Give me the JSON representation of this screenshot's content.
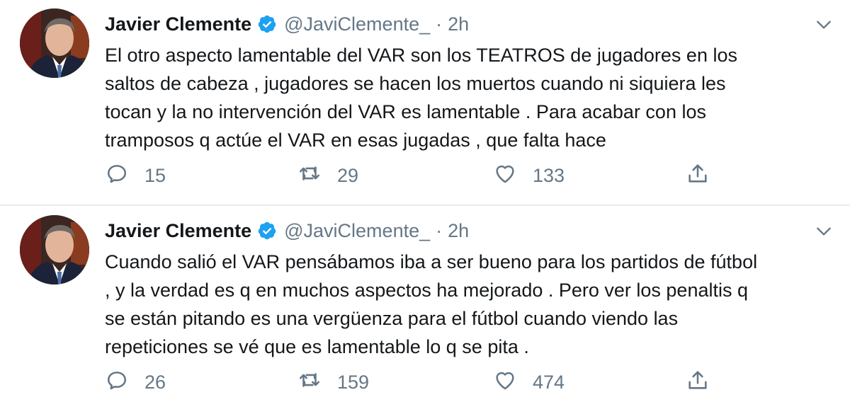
{
  "tweets": [
    {
      "name": "Javier Clemente",
      "handle": "@JaviClemente_",
      "separator": "·",
      "time": "2h",
      "text": "El otro aspecto lamentable del VAR son los TEATROS de jugadores en los\nsaltos de cabeza , jugadores se hacen los muertos cuando ni siquiera les\ntocan y la no intervención del VAR es lamentable . Para acabar con los\ntramposos q actúe el VAR en esas jugadas , que falta hace",
      "replies": "15",
      "retweets": "29",
      "likes": "133"
    },
    {
      "name": "Javier Clemente",
      "handle": "@JaviClemente_",
      "separator": "·",
      "time": "2h",
      "text": "Cuando salió el VAR pensábamos iba a ser bueno para los partidos de fútbol\n, y la verdad es q en muchos aspectos ha mejorado . Pero ver los penaltis q\nse están pitando es una vergüenza para el fútbol cuando viendo las\nrepeticiones se vé que es lamentable lo q se pita .",
      "replies": "26",
      "retweets": "159",
      "likes": "474"
    }
  ],
  "icons": {
    "reply": "reply-icon",
    "retweet": "retweet-icon",
    "like": "heart-icon",
    "share": "share-icon",
    "verified": "verified-badge-icon",
    "caret": "chevron-down-icon"
  },
  "colors": {
    "text": "#14171a",
    "secondary": "#657786",
    "verified": "#1da1f2",
    "divider": "#e6ecf0"
  }
}
